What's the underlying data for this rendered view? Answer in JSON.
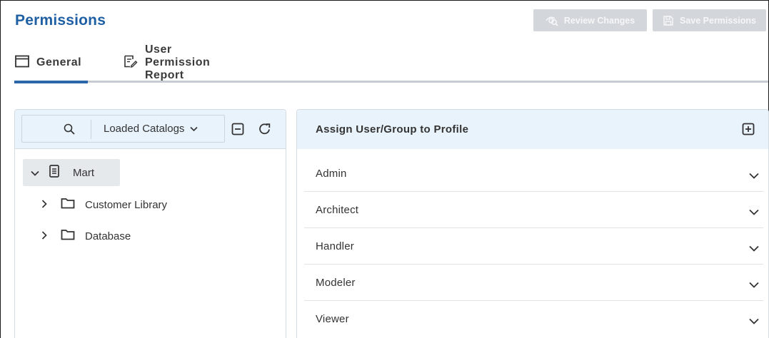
{
  "page": {
    "title": "Permissions"
  },
  "toolbar": {
    "review_label": "Review Changes",
    "save_label": "Save Permissions"
  },
  "tabs": [
    {
      "label": "General",
      "icon": "window-icon",
      "active": true
    },
    {
      "label": "User Permission Report",
      "icon": "report-icon",
      "active": false
    }
  ],
  "left_panel": {
    "catalog_select": "Loaded Catalogs",
    "tree": {
      "root": {
        "label": "Mart",
        "icon": "document-icon",
        "expanded": true
      },
      "children": [
        {
          "label": "Customer Library",
          "icon": "folder-icon",
          "expanded": false
        },
        {
          "label": "Database",
          "icon": "folder-icon",
          "expanded": false
        }
      ]
    }
  },
  "right_panel": {
    "title": "Assign User/Group to Profile",
    "profiles": [
      {
        "label": "Admin"
      },
      {
        "label": "Architect"
      },
      {
        "label": "Handler"
      },
      {
        "label": "Modeler"
      },
      {
        "label": "Viewer"
      }
    ]
  },
  "colors": {
    "accent": "#1f5fa3",
    "header_bg": "#e9f3fc",
    "disabled_button": "#d3d6da"
  }
}
